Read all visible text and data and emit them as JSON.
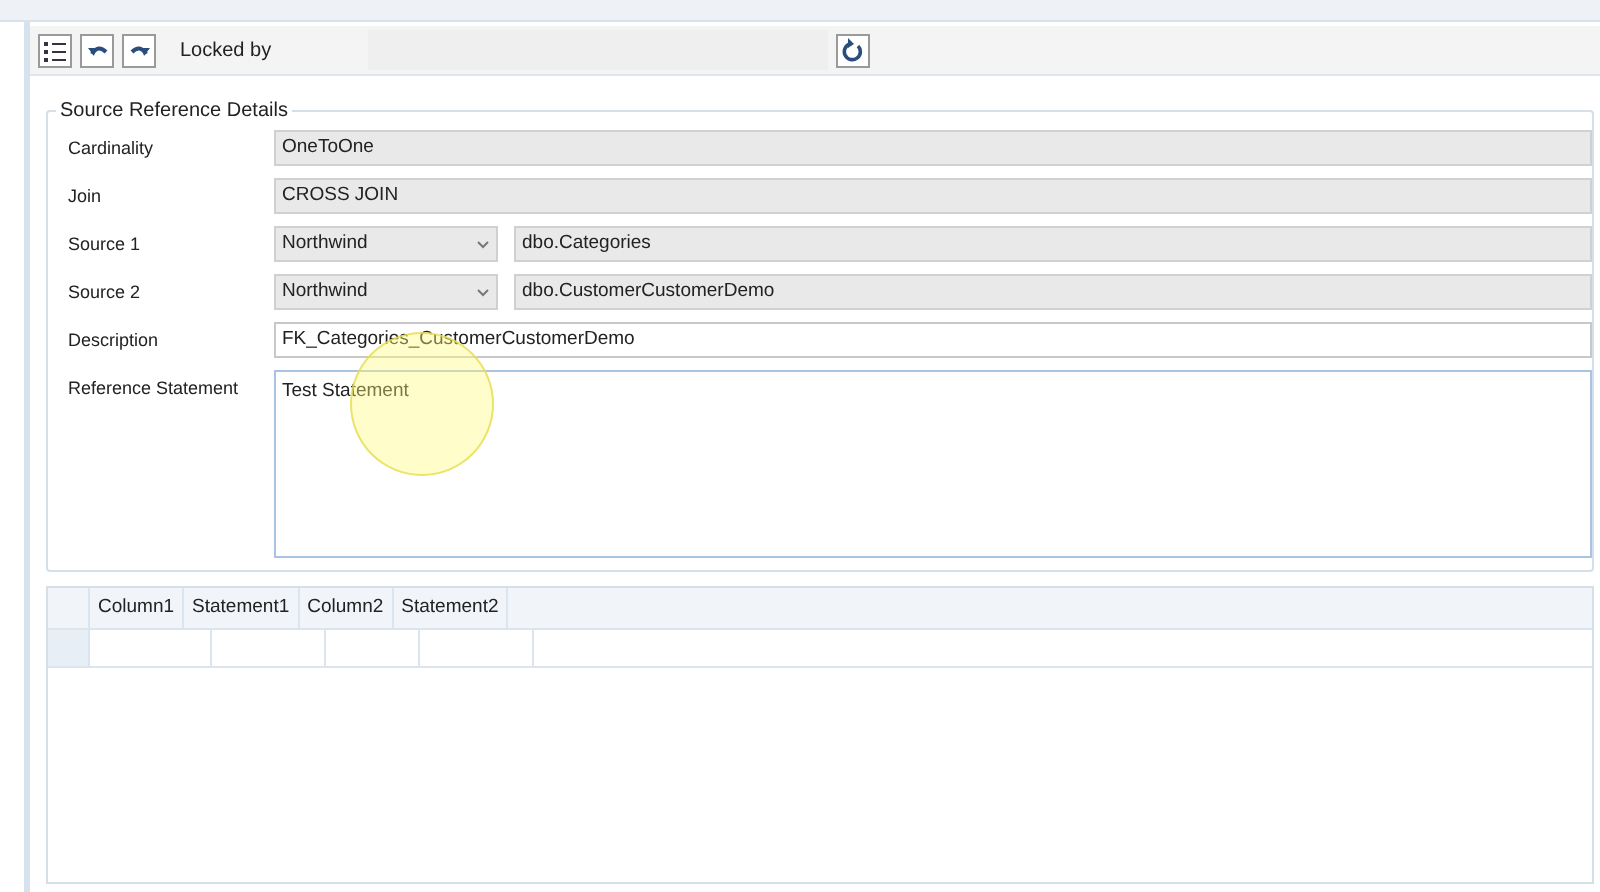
{
  "toolbar": {
    "locked_by_label": "Locked by"
  },
  "group": {
    "title": "Source Reference Details",
    "rows": [
      {
        "kind": "text",
        "label": "Cardinality",
        "value": "OneToOne"
      },
      {
        "kind": "text",
        "label": "Join",
        "value": "CROSS JOIN"
      },
      {
        "kind": "source",
        "label": "Source 1",
        "database": "Northwind",
        "table": "dbo.Categories"
      },
      {
        "kind": "source",
        "label": "Source 2",
        "database": "Northwind",
        "table": "dbo.CustomerCustomerDemo"
      },
      {
        "kind": "edit",
        "label": "Description",
        "value": "FK_Categories_CustomerCustomerDemo"
      },
      {
        "kind": "memo",
        "label": "Reference Statement",
        "value": "Test Statement"
      }
    ]
  },
  "table": {
    "columns": [
      "Column1",
      "Statement1",
      "Column2",
      "Statement2"
    ]
  }
}
